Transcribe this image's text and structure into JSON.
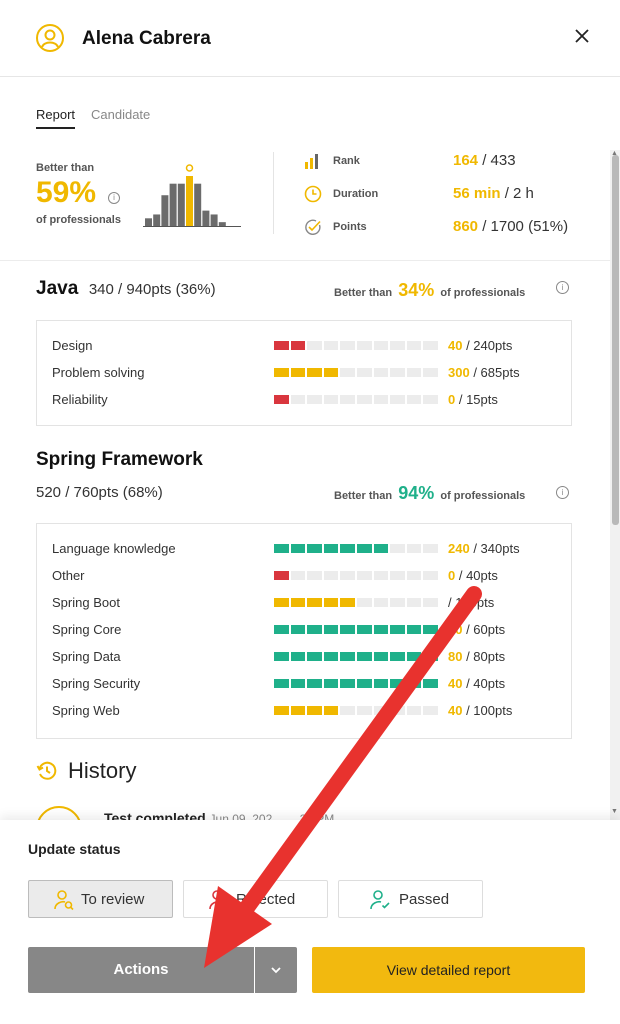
{
  "header": {
    "candidate_name": "Alena Cabrera"
  },
  "tabs": [
    {
      "label": "Report",
      "active": true
    },
    {
      "label": "Candidate",
      "active": false
    }
  ],
  "summary": {
    "better_than_label": "Better than",
    "percent": "59%",
    "of_professionals_label": "of professionals",
    "histogram_values": [
      2,
      3,
      8,
      11,
      11,
      13,
      11,
      4,
      3,
      1
    ],
    "candidate_bin_index": 5,
    "stats": [
      {
        "icon": "rank-bars-icon",
        "label": "Rank",
        "value": "164",
        "total": " / 433"
      },
      {
        "icon": "clock-icon",
        "label": "Duration",
        "value": "56 min",
        "total": " / 2 h"
      },
      {
        "icon": "check-circle-icon",
        "label": "Points",
        "value": "860",
        "total": " / 1700 (51%)"
      }
    ]
  },
  "skills": [
    {
      "title": "Java",
      "score": "340 / 940pts (36%)",
      "better_than_label": "Better than",
      "percent": "34%",
      "of_professionals_label": "of professionals",
      "accent": "gold",
      "rows": [
        {
          "label": "Design",
          "fill": 2,
          "color": "#d9363e",
          "score": "40",
          "total": " / 240pts"
        },
        {
          "label": "Problem solving",
          "fill": 4,
          "color": "#f0b800",
          "score": "300",
          "total": " / 685pts"
        },
        {
          "label": "Reliability",
          "fill": 1,
          "color": "#d9363e",
          "score": "0",
          "total": " / 15pts"
        }
      ]
    },
    {
      "title": "Spring Framework",
      "score": "520 / 760pts (68%)",
      "better_than_label": "Better than",
      "percent": "94%",
      "of_professionals_label": "of professionals",
      "accent": "green",
      "rows": [
        {
          "label": "Language knowledge",
          "fill": 7,
          "color": "#1fb08a",
          "score": "240",
          "total": " / 340pts"
        },
        {
          "label": "Other",
          "fill": 1,
          "color": "#d9363e",
          "score": "0",
          "total": " / 40pts"
        },
        {
          "label": "Spring Boot",
          "fill": 5,
          "color": "#f0b800",
          "score": "",
          "total": "/ 100pts"
        },
        {
          "label": "Spring Core",
          "fill": 10,
          "color": "#1fb08a",
          "score": "60",
          "total": " / 60pts"
        },
        {
          "label": "Spring Data",
          "fill": 10,
          "color": "#1fb08a",
          "score": "80",
          "total": " / 80pts"
        },
        {
          "label": "Spring Security",
          "fill": 10,
          "color": "#1fb08a",
          "score": "40",
          "total": " / 40pts"
        },
        {
          "label": "Spring Web",
          "fill": 4,
          "color": "#f0b800",
          "score": "40",
          "total": " / 100pts"
        }
      ]
    }
  ],
  "history": {
    "title": "History",
    "first_item": "Test completed",
    "first_item_date": "Jun 09, 202… …21 PM"
  },
  "footer": {
    "update_status_label": "Update status",
    "status_buttons": [
      {
        "label": "To review",
        "icon": "person-search-icon",
        "selected": true
      },
      {
        "label": "Rejected",
        "icon": "person-x-icon",
        "selected": false
      },
      {
        "label": "Passed",
        "icon": "person-check-icon",
        "selected": false
      }
    ],
    "actions_label": "Actions",
    "view_report_label": "View detailed report"
  },
  "colors": {
    "accent_gold": "#f0b800",
    "accent_green": "#1fb08a",
    "accent_red": "#d9363e",
    "annotation_arrow": "#e8322e"
  }
}
